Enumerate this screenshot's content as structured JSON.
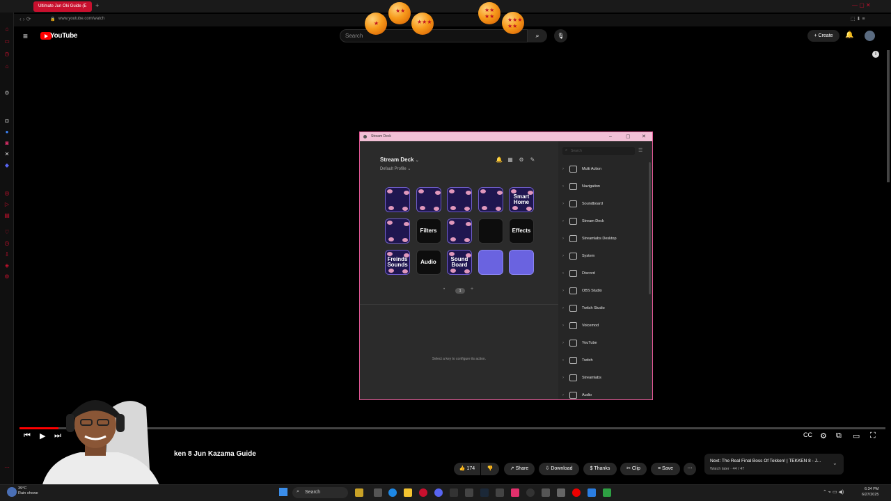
{
  "browser": {
    "tab_title": "Ultimate Jun Oki Guide (E",
    "url": "www.youtube.com/watch"
  },
  "youtube": {
    "brand": "YouTube",
    "search_placeholder": "Search",
    "create_label": "Create"
  },
  "stream_deck": {
    "window_title": "Stream Deck",
    "device_name": "Stream Deck",
    "profile": "Default Profile",
    "page": "1",
    "keys": [
      {
        "label": "",
        "style": "purple"
      },
      {
        "label": "",
        "style": "purple"
      },
      {
        "label": "",
        "style": "purple"
      },
      {
        "label": "",
        "style": "purple"
      },
      {
        "label": "Smart Home",
        "style": "purple"
      },
      {
        "label": "",
        "style": "purple"
      },
      {
        "label": "Filters",
        "style": "dark"
      },
      {
        "label": "",
        "style": "purple"
      },
      {
        "label": "",
        "style": "dark"
      },
      {
        "label": "Effects",
        "style": "dark"
      },
      {
        "label": "Freinds Sounds",
        "style": "purple"
      },
      {
        "label": "Audio",
        "style": "dark"
      },
      {
        "label": "Sound Board",
        "style": "purple"
      },
      {
        "label": "",
        "style": "blue"
      },
      {
        "label": "",
        "style": "blue"
      }
    ],
    "hint": "Select a key to configure its action.",
    "search_placeholder": "Search",
    "categories": [
      "Multi Action",
      "Navigation",
      "Soundboard",
      "Stream Deck",
      "Streamlabs Desktop",
      "System",
      "Discord",
      "OBS Studio",
      "Twitch Studio",
      "Voicemod",
      "YouTube",
      "Twitch",
      "Streamlabs",
      "Audio"
    ]
  },
  "video": {
    "title": "ken 8 Jun Kazama Guide",
    "likes": "174",
    "share_label": "Share",
    "download_label": "Download",
    "thanks_label": "Thanks",
    "clip_label": "Clip",
    "save_label": "Save",
    "next_title": "Next: The Real Final Boss Of Tekken! | TEKKEN 8 - J...",
    "next_sub": "Watch later · 44 / 47"
  },
  "taskbar": {
    "search_label": "Search",
    "weather_temp": "39°C",
    "weather_text": "Rain showe",
    "time": "6:34 PM",
    "date": "6/27/2025"
  },
  "colors": {
    "accent": "#c8102e",
    "sd_border": "#e85a9a",
    "key_purple": "#1f1650",
    "key_blue": "#6a63e0"
  }
}
